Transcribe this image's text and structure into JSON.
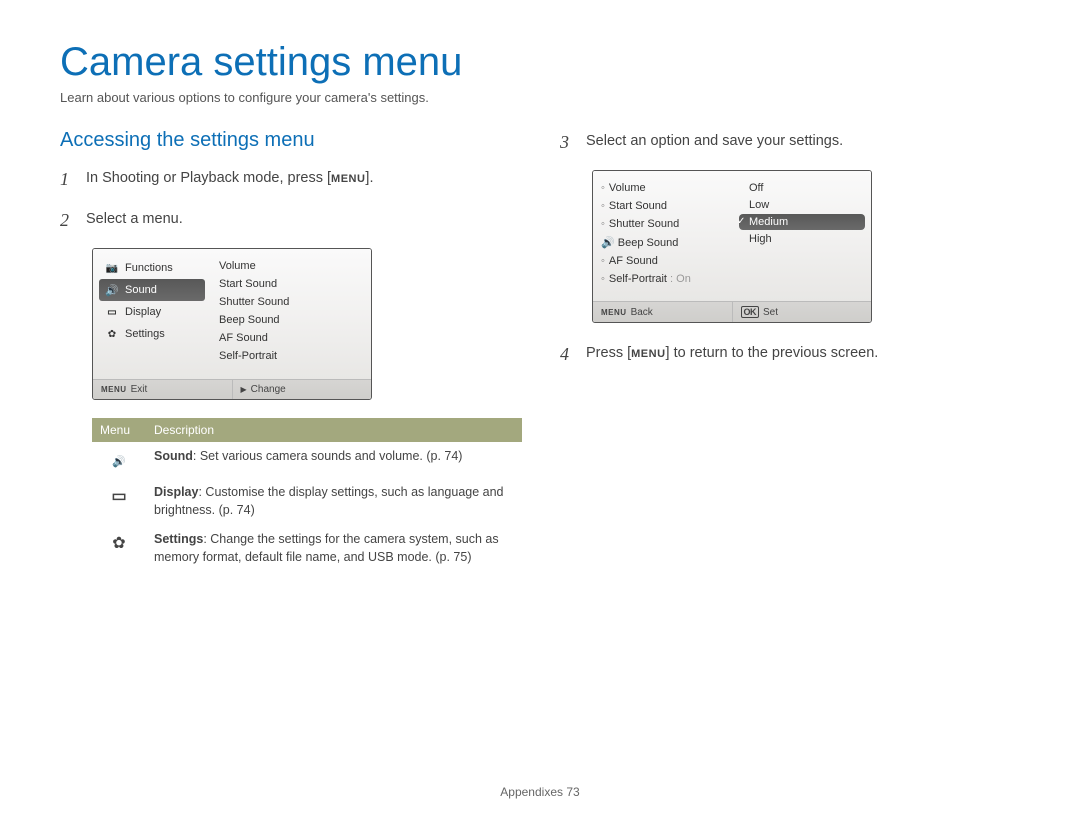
{
  "page_title": "Camera settings menu",
  "page_subtitle": "Learn about various options to configure your camera's settings.",
  "section_heading": "Accessing the settings menu",
  "steps": {
    "s1_pre": "In Shooting or Playback mode, press [",
    "s1_label": "MENU",
    "s1_post": "].",
    "s2": "Select a menu.",
    "s3": "Select an option and save your settings.",
    "s4_pre": "Press [",
    "s4_label": "MENU",
    "s4_post": "] to return to the previous screen."
  },
  "screen1": {
    "left_items": [
      "Functions",
      "Sound",
      "Display",
      "Settings"
    ],
    "selected_index": 1,
    "right_items": [
      "Volume",
      "Start Sound",
      "Shutter Sound",
      "Beep Sound",
      "AF Sound",
      "Self-Portrait"
    ],
    "footer_left_icon": "MENU",
    "footer_left": "Exit",
    "footer_right_icon": "▶",
    "footer_right": "Change"
  },
  "screen2": {
    "left_items": [
      "Volume",
      "Start Sound",
      "Shutter Sound",
      "Beep Sound",
      "AF Sound",
      "Self-Portrait"
    ],
    "left_highlight_index": 3,
    "selfportrait_value": ": On",
    "right_items": [
      "Off",
      "Low",
      "Medium",
      "High"
    ],
    "right_selected_index": 2,
    "footer_left_icon": "MENU",
    "footer_left": "Back",
    "footer_right_icon": "OK",
    "footer_right": "Set"
  },
  "table": {
    "headers": [
      "Menu",
      "Description"
    ],
    "rows": [
      {
        "icon": "sound",
        "bold": "Sound",
        "rest": ": Set various camera sounds and volume. (p. 74)"
      },
      {
        "icon": "display",
        "bold": "Display",
        "rest": ": Customise the display settings, such as language and brightness. (p. 74)"
      },
      {
        "icon": "gear",
        "bold": "Settings",
        "rest": ": Change the settings for the camera system, such as memory format, default file name, and USB mode. (p. 75)"
      }
    ]
  },
  "footer": {
    "label": "Appendixes",
    "page": "73"
  }
}
